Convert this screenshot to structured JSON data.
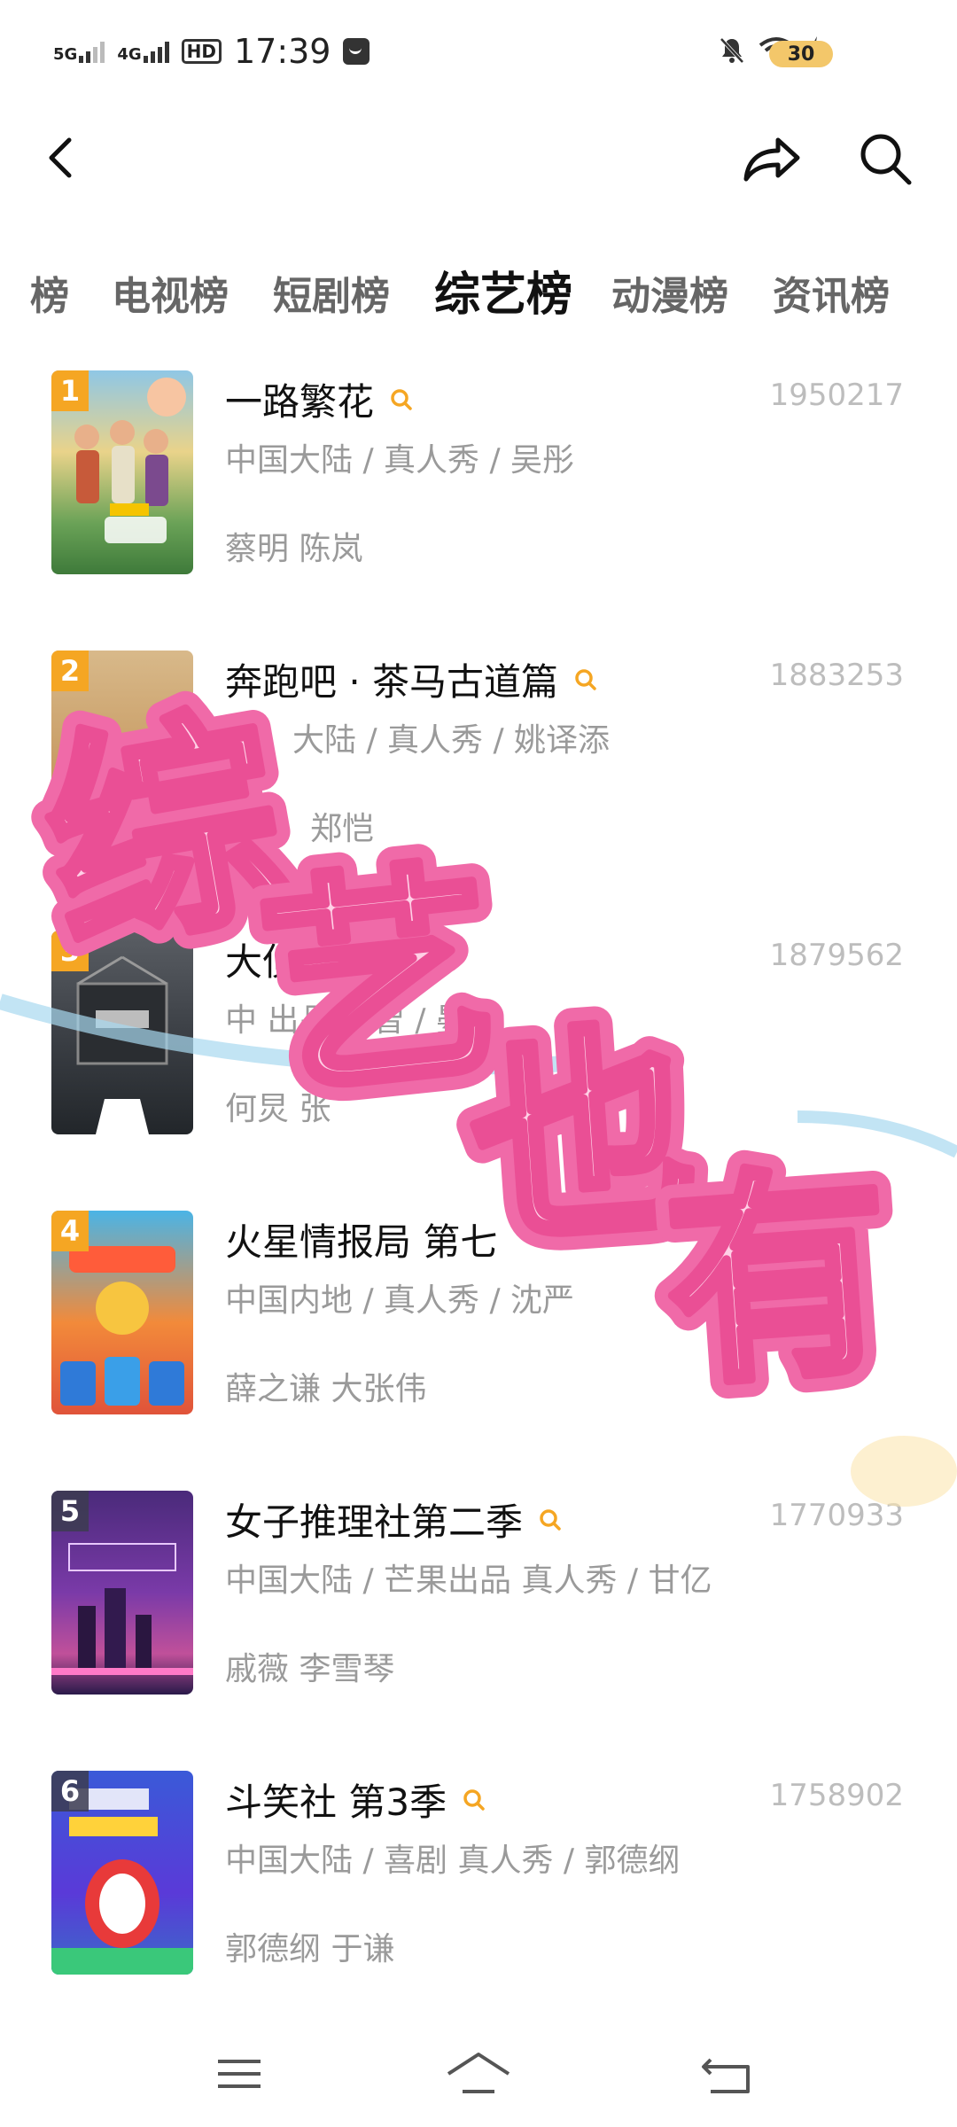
{
  "status_bar": {
    "net1": "5G",
    "net2": "4G",
    "hd": "HD",
    "time": "17:39",
    "battery": "30"
  },
  "tabs": [
    {
      "label": "榜"
    },
    {
      "label": "电视榜"
    },
    {
      "label": "短剧榜"
    },
    {
      "label": "综艺榜"
    },
    {
      "label": "动漫榜"
    },
    {
      "label": "资讯榜"
    }
  ],
  "active_tab": "综艺榜",
  "items": [
    {
      "rank": "1",
      "title": "一路繁花",
      "score": "1950217",
      "meta": "中国大陆 / 真人秀 / 吴彤",
      "cast": "蔡明 陈岚"
    },
    {
      "rank": "2",
      "title": "奔跑吧 · 茶马古道篇",
      "score": "1883253",
      "meta": "大陆 / 真人秀 / 姚译添",
      "cast": "郑恺"
    },
    {
      "rank": "3",
      "title": "大侦探",
      "score": "1879562",
      "meta": "中 出品 益智 / 晏吉",
      "cast": "何炅 张"
    },
    {
      "rank": "4",
      "title": "火星情报局 第七",
      "score": "",
      "meta": "中国内地 / 真人秀 / 沈严",
      "cast": "薛之谦 大张伟"
    },
    {
      "rank": "5",
      "title": "女子推理社第二季",
      "score": "1770933",
      "meta": "中国大陆 / 芒果出品 真人秀 / 甘亿",
      "cast": "戚薇 李雪琴"
    },
    {
      "rank": "6",
      "title": "斗笑社 第3季",
      "score": "1758902",
      "meta": "中国大陆 / 喜剧 真人秀 / 郭德纲",
      "cast": "郭德纲 于谦"
    }
  ],
  "sticker_text": [
    "综",
    "艺",
    "也",
    "有"
  ],
  "colors": {
    "accent": "#f5a623",
    "pink": "#f06aa8",
    "pink_light": "#ffd0e6"
  }
}
